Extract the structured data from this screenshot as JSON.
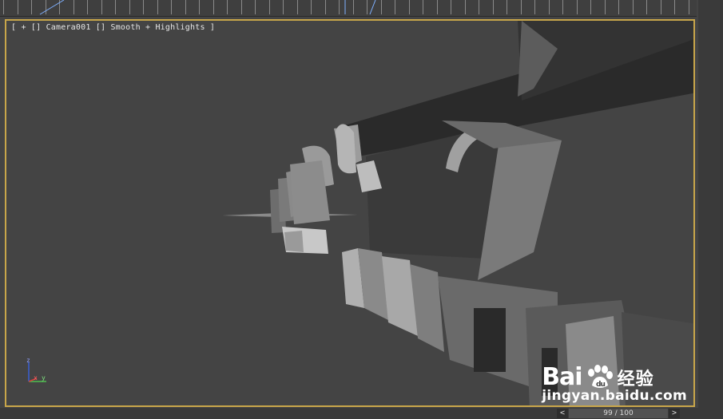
{
  "viewport": {
    "label_open": "[ ",
    "plus": "+",
    "camera": "Camera001",
    "shading": "Smooth + Highlights",
    "label_close": " ]"
  },
  "gizmo": {
    "z_label": "z",
    "x_label": "x",
    "y_label": "y"
  },
  "time_slider": {
    "prev": "<",
    "frame": "99 / 100",
    "next": ">"
  },
  "watermark": {
    "brand_left": "Bai",
    "brand_cn": "经验",
    "url": "jingyan.baidu.com"
  },
  "colors": {
    "viewport_border": "#c8a64a",
    "viewport_bg": "#444444",
    "axis_x": "#d43a3a",
    "axis_y": "#4fbf4f",
    "axis_z": "#3a5fd4"
  }
}
